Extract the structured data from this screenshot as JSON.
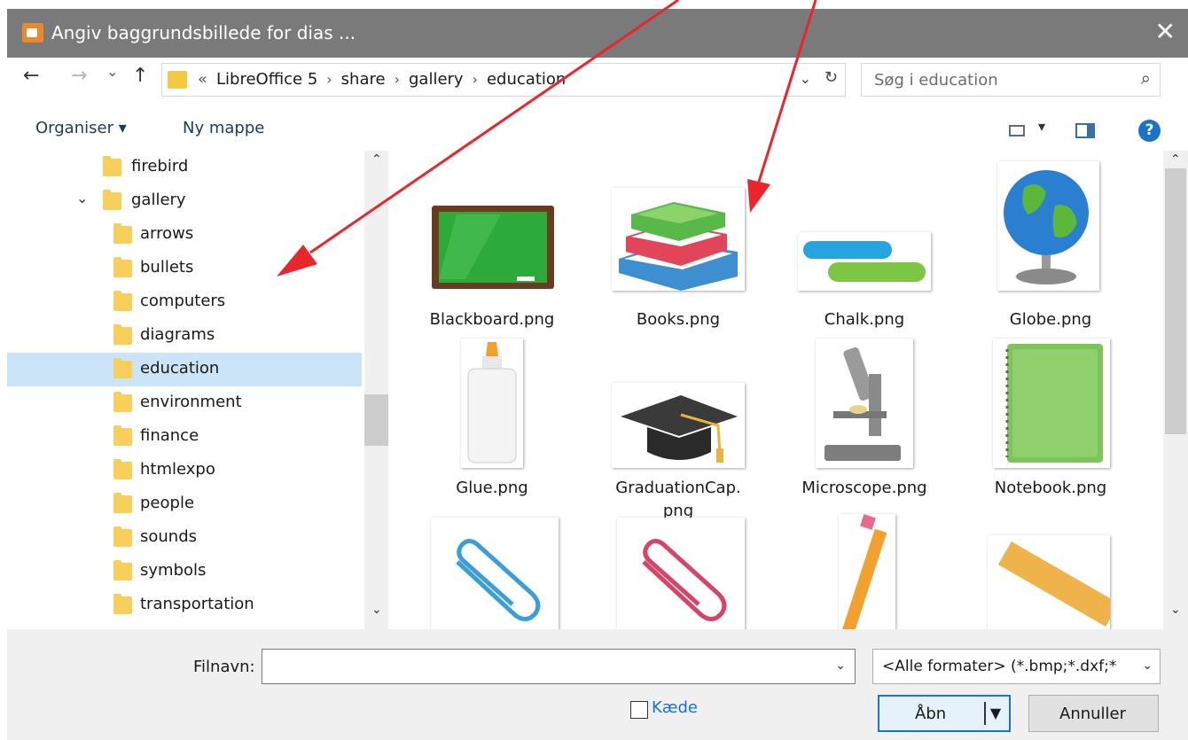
{
  "window": {
    "title": "Angiv baggrundsbillede for dias ...",
    "close_glyph": "✕"
  },
  "navbar": {
    "back_glyph": "←",
    "forward_glyph": "→",
    "recent_glyph": "⌄",
    "up_glyph": "↑",
    "crumbs_lead": "«",
    "crumbs": [
      "LibreOffice 5",
      "share",
      "gallery",
      "education"
    ],
    "crumb_separator": "›",
    "dropdown_glyph": "⌄",
    "refresh_glyph": "↻",
    "search_placeholder": "Søg i education",
    "search_glyph": "⌕"
  },
  "toolbar": {
    "organize_label": "Organiser ▾",
    "new_folder_label": "Ny mappe",
    "view_dropdown_glyph": "▾",
    "help_glyph": "?"
  },
  "tree": {
    "items": [
      {
        "label": "firebird",
        "level": 1
      },
      {
        "label": "gallery",
        "level": 1,
        "expanded": true
      },
      {
        "label": "arrows",
        "level": 2
      },
      {
        "label": "bullets",
        "level": 2
      },
      {
        "label": "computers",
        "level": 2
      },
      {
        "label": "diagrams",
        "level": 2
      },
      {
        "label": "education",
        "level": 2,
        "selected": true
      },
      {
        "label": "environment",
        "level": 2
      },
      {
        "label": "finance",
        "level": 2
      },
      {
        "label": "htmlexpo",
        "level": 2
      },
      {
        "label": "people",
        "level": 2
      },
      {
        "label": "sounds",
        "level": 2
      },
      {
        "label": "symbols",
        "level": 2
      },
      {
        "label": "transportation",
        "level": 2
      }
    ],
    "expand_glyph": "⌄",
    "scroll_up_glyph": "⌃",
    "scroll_down_glyph": "⌄"
  },
  "files": {
    "items": [
      {
        "name": "Blackboard.png",
        "icon": "blackboard"
      },
      {
        "name": "Books.png",
        "icon": "books"
      },
      {
        "name": "Chalk.png",
        "icon": "chalk"
      },
      {
        "name": "Globe.png",
        "icon": "globe"
      },
      {
        "name": "Glue.png",
        "icon": "glue"
      },
      {
        "name": "GraduationCap.png",
        "name_line1": "GraduationCap.",
        "name_line2": "png",
        "icon": "graduation-cap"
      },
      {
        "name": "Microscope.png",
        "icon": "microscope"
      },
      {
        "name": "Notebook.png",
        "icon": "notebook"
      },
      {
        "name": "",
        "icon": "paperclip-blue"
      },
      {
        "name": "",
        "icon": "paperclip-red"
      },
      {
        "name": "",
        "icon": "pencil"
      },
      {
        "name": "",
        "icon": "ruler"
      }
    ],
    "scroll_up_glyph": "⌃",
    "scroll_down_glyph": "⌄"
  },
  "bottom": {
    "filename_label": "Filnavn:",
    "filename_value": "",
    "filter_value": "<Alle formater> (*.bmp;*.dxf;*",
    "filter_dropdown_glyph": "⌄",
    "filename_dropdown_glyph": "⌄",
    "link_label": "Kæde",
    "open_label": "Åbn",
    "open_split_glyph": "▼",
    "cancel_label": "Annuller"
  },
  "colors": {
    "titlebar": "#7a7a7a",
    "selection": "#cce4f7",
    "accent": "#1a73c8",
    "annotation_arrow": "#e8262b"
  }
}
